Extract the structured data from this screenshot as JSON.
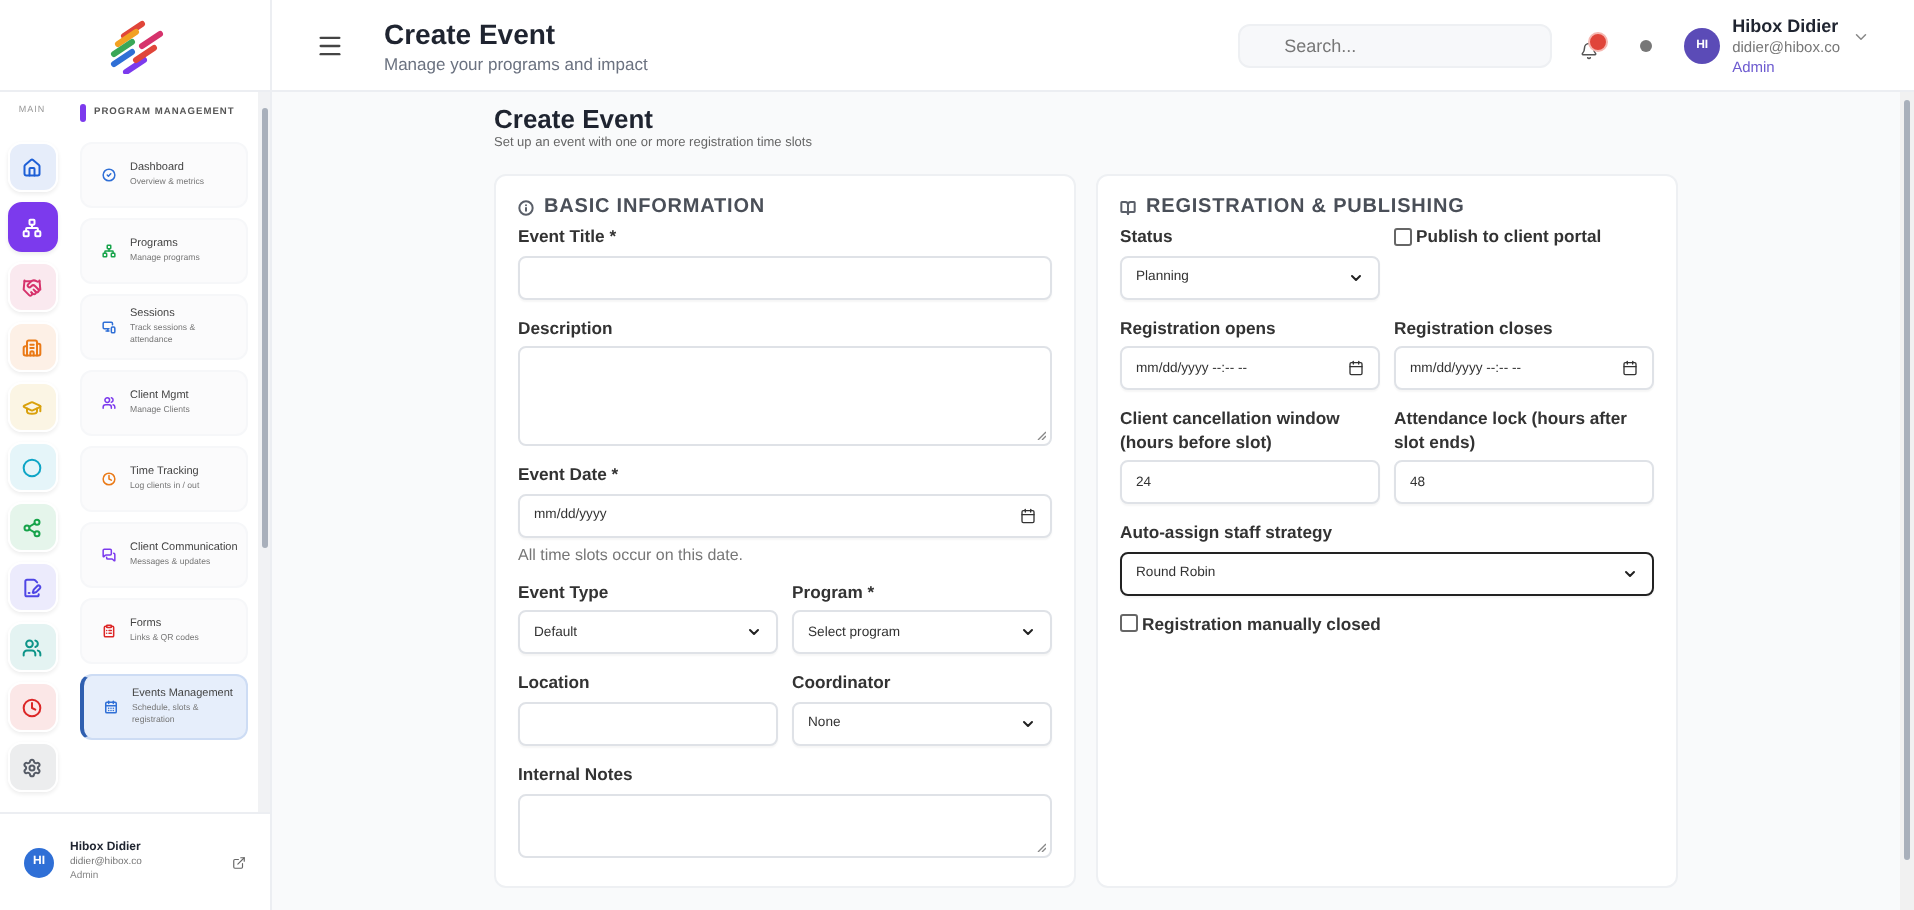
{
  "header": {
    "title": "Create Event",
    "subtitle": "Manage your programs and impact",
    "search": {
      "placeholder": "Search..."
    },
    "user": {
      "initials": "HI",
      "name": "Hibox Didier",
      "email": "didier@hibox.co",
      "role": "Admin"
    }
  },
  "sidebar": {
    "rail_label": "MAIN",
    "rail": [
      {
        "selected": false,
        "color": "#1d5fd6"
      },
      {
        "selected": true,
        "color": "#7c3aed"
      },
      {
        "selected": false,
        "color": "#d6336c"
      },
      {
        "selected": false,
        "color": "#ea7a17"
      },
      {
        "selected": false,
        "color": "#d9a10c"
      },
      {
        "selected": false,
        "color": "#0ea5c6"
      },
      {
        "selected": false,
        "color": "#16a34a"
      },
      {
        "selected": false,
        "color": "#4f46e5"
      },
      {
        "selected": false,
        "color": "#0d9488"
      },
      {
        "selected": false,
        "color": "#dc2626"
      },
      {
        "selected": false,
        "color": "#555b66"
      }
    ],
    "section": "PROGRAM MANAGEMENT",
    "items": [
      {
        "title": "Dashboard",
        "subtitle": "Overview & metrics",
        "selected": false
      },
      {
        "title": "Programs",
        "subtitle": "Manage programs",
        "selected": false
      },
      {
        "title": "Sessions",
        "subtitle": "Track sessions & attendance",
        "selected": false
      },
      {
        "title": "Client Mgmt",
        "subtitle": "Manage Clients",
        "selected": false
      },
      {
        "title": "Time Tracking",
        "subtitle": "Log clients in / out",
        "selected": false
      },
      {
        "title": "Client Communication",
        "subtitle": "Messages & updates",
        "selected": false
      },
      {
        "title": "Forms",
        "subtitle": "Links & QR codes",
        "selected": false
      },
      {
        "title": "Events Management",
        "subtitle": "Schedule, slots & registration",
        "selected": true
      }
    ],
    "user": {
      "initials": "HI",
      "name": "Hibox Didier",
      "email": "didier@hibox.co",
      "role": "Admin"
    }
  },
  "page": {
    "title": "Create Event",
    "subtitle": "Set up an event with one or more registration time slots"
  },
  "basic_information": {
    "title": "BASIC INFORMATION",
    "rows": [
      [
        {
          "kind": "text",
          "label": "Event Title *",
          "focused": false
        }
      ],
      [
        {
          "kind": "textarea",
          "label": "Description",
          "focused": false
        }
      ],
      [
        {
          "kind": "date",
          "label": "Event Date *",
          "placeholder": "mm/dd/yyyy",
          "hint": "All time slots occur on this date.",
          "focused": false
        }
      ],
      [
        {
          "kind": "select",
          "label": "Event Type",
          "value": "Default",
          "focused": false
        },
        {
          "kind": "select",
          "label": "Program *",
          "value": "Select program",
          "focused": false
        }
      ],
      [
        {
          "kind": "text",
          "label": "Location",
          "focused": false
        },
        {
          "kind": "select",
          "label": "Coordinator",
          "value": "None",
          "focused": false
        }
      ],
      [
        {
          "kind": "textarea",
          "label": "Internal Notes",
          "focused": false
        }
      ]
    ]
  },
  "registration_publishing": {
    "title": "REGISTRATION & PUBLISHING",
    "rows": [
      [
        {
          "kind": "select",
          "label": "Status",
          "value": "Planning",
          "focused": false
        },
        {
          "kind": "checkbox",
          "label": "Publish to client portal",
          "checked": false
        }
      ],
      [
        {
          "kind": "datetime",
          "label": "Registration opens",
          "placeholder": "mm/dd/yyyy --:-- --",
          "focused": false
        },
        {
          "kind": "datetime",
          "label": "Registration closes",
          "placeholder": "mm/dd/yyyy --:-- --",
          "focused": false
        }
      ],
      [
        {
          "kind": "text",
          "label": "Client cancellation window (hours before slot)",
          "value": "24",
          "focused": false
        },
        {
          "kind": "text",
          "label": "Attendance lock (hours after slot ends)",
          "value": "48",
          "focused": false
        }
      ],
      [
        {
          "kind": "select",
          "label": "Auto-assign staff strategy",
          "value": "Round Robin",
          "focused": true
        }
      ],
      [
        {
          "kind": "checkbox",
          "label": "Registration manually closed",
          "checked": false
        }
      ]
    ]
  }
}
